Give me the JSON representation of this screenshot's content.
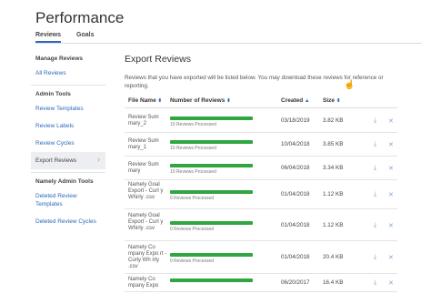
{
  "header": {
    "title": "Performance"
  },
  "tabs": [
    {
      "label": "Reviews"
    },
    {
      "label": "Goals"
    }
  ],
  "sidebar": {
    "sections": [
      {
        "heading": "Manage Reviews",
        "items": [
          "All Reviews"
        ]
      },
      {
        "heading": "Admin Tools",
        "items": [
          "Review Templates",
          "Review Labels",
          "Review Cycles",
          "Export Reviews"
        ]
      },
      {
        "heading": "Namely Admin Tools",
        "items": [
          "Deleted Review Templates",
          "Deleted Review Cycles"
        ]
      }
    ],
    "active_item": "Export Reviews",
    "chevron_icon": "chevron-right-icon"
  },
  "main": {
    "title": "Export Reviews",
    "description": "Reviews that you have exported will be listed below. You may download these reviews for reference or reporting.",
    "columns": {
      "file_name": "File Name",
      "num_reviews": "Number of Reviews",
      "created": "Created",
      "size": "Size"
    },
    "rows": [
      {
        "name": "Review Sum mary_2",
        "processed": "10 Reviews Processed",
        "progress": 1.0,
        "created": "03/18/2019",
        "size": "3.82 KB"
      },
      {
        "name": "Review Sum mary_1",
        "processed": "10 Reviews Processed",
        "progress": 1.0,
        "created": "10/04/2018",
        "size": "3.85 KB"
      },
      {
        "name": "Review Sum mary",
        "processed": "10 Reviews Processed",
        "progress": 1.0,
        "created": "06/04/2018",
        "size": "3.34 KB"
      },
      {
        "name": "Namely Goal Export - Curl y Whirly .csv",
        "processed": "0 Reviews Processed",
        "progress": 1.0,
        "created": "01/04/2018",
        "size": "1.12 KB"
      },
      {
        "name": "Namely Goal Export - Curl y Whirly .csv",
        "processed": "0 Reviews Processed",
        "progress": 1.0,
        "created": "01/04/2018",
        "size": "1.12 KB"
      },
      {
        "name": "Namely Co mpany Expo rt - Curly Wh irly .csv",
        "processed": "0 Reviews Processed",
        "progress": 1.0,
        "created": "01/04/2018",
        "size": "20.4 KB"
      },
      {
        "name": "Namely Co mpany Expo",
        "processed": "",
        "progress": 1.0,
        "created": "06/20/2017",
        "size": "16.4 KB"
      }
    ],
    "icons": {
      "download": "download-icon",
      "delete": "delete-icon",
      "sort": "sort-icon",
      "cursor": "mouse-cursor-icon"
    },
    "colors": {
      "progress": "#2fa640",
      "link": "#2a6ab8",
      "action_icon": "#7fa6d6"
    }
  }
}
